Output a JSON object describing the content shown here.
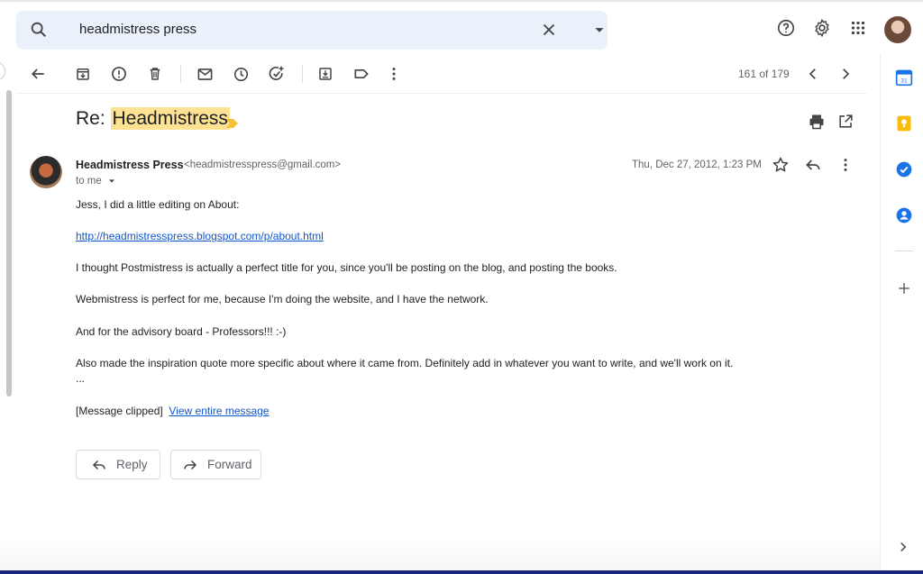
{
  "search": {
    "query": "headmistress press",
    "icon": "search-icon"
  },
  "toolbar": {
    "pager_text": "161 of 179"
  },
  "email": {
    "subject_prefix": "Re: ",
    "subject_highlight": "Headmistress",
    "sender_name": "Headmistress Press",
    "sender_email": "<headmistresspress@gmail.com>",
    "recipient": "to me",
    "date": "Thu, Dec 27, 2012, 1:23 PM",
    "body": {
      "line1": "Jess, I did a little editing on About:",
      "link": "http://headmistresspress.blogspot.com/p/about.html",
      "line3": "I thought Postmistress is actually a perfect title for you, since you'll be posting on the blog, and posting the books.",
      "line4": "Webmistress is perfect for me, because I'm doing the website, and I have the network.",
      "line5": "And for the advisory board - Professors!!! :-)",
      "line6": "Also made the inspiration quote more specific about where it came from. Definitely add in whatever you want to write, and we'll work on it.",
      "ellipsis": "...",
      "clipped": "[Message clipped]",
      "view_entire": "View entire message"
    }
  },
  "actions": {
    "reply": "Reply",
    "forward": "Forward"
  },
  "colors": {
    "highlight": "#fde293",
    "link": "#1155cc",
    "search_bg": "#eaf1fb",
    "calendar": "#1a73e8",
    "keep": "#fbbc04",
    "tasks": "#1a73e8",
    "contacts": "#1a73e8"
  }
}
